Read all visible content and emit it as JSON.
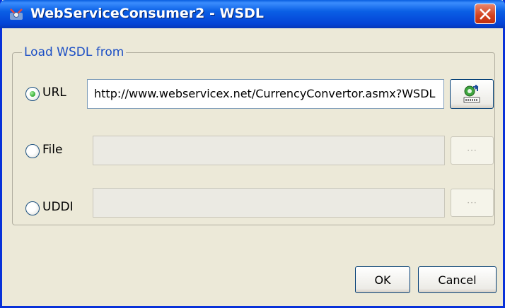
{
  "window": {
    "title": "WebServiceConsumer2 - WSDL",
    "close_label": "✕"
  },
  "group": {
    "legend": "Load WSDL from"
  },
  "options": {
    "url": {
      "label": "URL",
      "selected": true,
      "value": "http://www.webservicex.net/CurrencyConvertor.asmx?WSDL",
      "button_icon": "fetch-wsdl-icon"
    },
    "file": {
      "label": "File",
      "selected": false,
      "value": "",
      "button_label": "···"
    },
    "uddi": {
      "label": "UDDI",
      "selected": false,
      "value": "",
      "button_label": "···"
    }
  },
  "buttons": {
    "ok": "OK",
    "cancel": "Cancel"
  },
  "colors": {
    "title_bar": "#0a5fe0",
    "legend_text": "#1c4fc5",
    "radio_dot": "#21a121",
    "close_button": "#d2411e"
  }
}
